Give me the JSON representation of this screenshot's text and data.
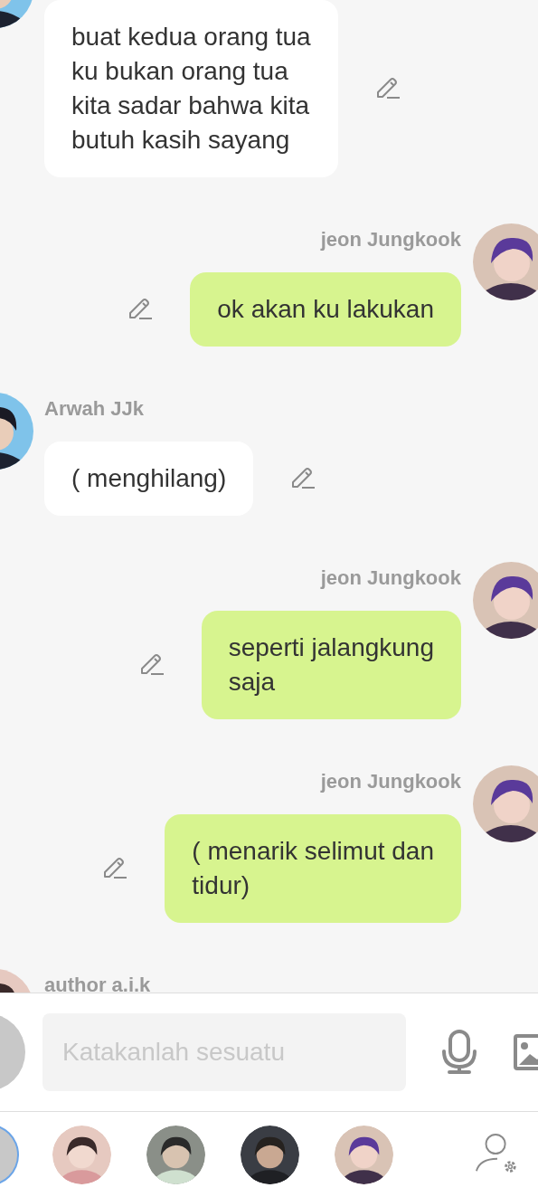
{
  "messages": [
    {
      "kind": "incoming",
      "text": "buat kedua orang tua\nku bukan orang tua\nkita sadar bahwa kita\nbutuh kasih sayang"
    },
    {
      "kind": "outgoing",
      "sender": "jeon Jungkook",
      "text": "ok akan ku lakukan"
    },
    {
      "kind": "incoming",
      "sender": "Arwah JJk",
      "text": "( menghilang)"
    },
    {
      "kind": "outgoing",
      "sender": "jeon Jungkook",
      "text": "seperti jalangkung\nsaja"
    },
    {
      "kind": "outgoing",
      "sender": "jeon Jungkook",
      "text": "( menarik selimut dan\ntidur)"
    },
    {
      "kind": "incoming",
      "sender": "author a.i.k"
    }
  ],
  "composer": {
    "placeholder": "Katakanlah sesuatu"
  },
  "contacts": [
    {
      "kind": "placeholder",
      "selected": true
    },
    {
      "kind": "picture",
      "selected": false
    },
    {
      "kind": "picture",
      "selected": false
    },
    {
      "kind": "picture",
      "selected": false
    },
    {
      "kind": "picture",
      "selected": false
    }
  ]
}
